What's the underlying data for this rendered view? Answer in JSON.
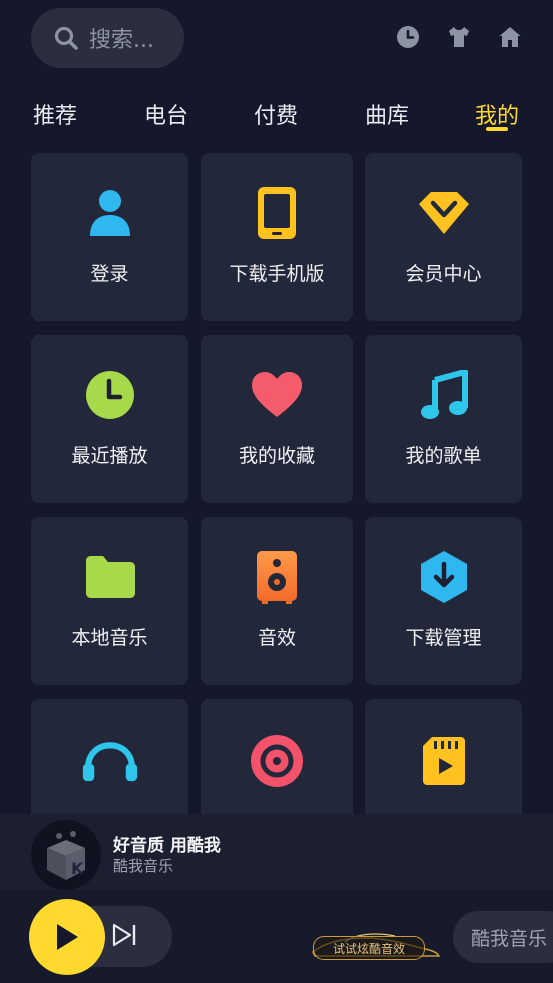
{
  "search": {
    "placeholder": "搜索..."
  },
  "tabs": [
    {
      "label": "推荐",
      "active": false
    },
    {
      "label": "电台",
      "active": false
    },
    {
      "label": "付费",
      "active": false
    },
    {
      "label": "曲库",
      "active": false
    },
    {
      "label": "我的",
      "active": true
    }
  ],
  "colors": {
    "accent": "#ffd92e",
    "background": "#15182a",
    "tile": "#23273a"
  },
  "tiles": [
    {
      "label": "登录",
      "icon": "user-icon"
    },
    {
      "label": "下载手机版",
      "icon": "phone-icon"
    },
    {
      "label": "会员中心",
      "icon": "vip-diamond-icon"
    },
    {
      "label": "最近播放",
      "icon": "clock-icon"
    },
    {
      "label": "我的收藏",
      "icon": "heart-icon"
    },
    {
      "label": "我的歌单",
      "icon": "music-note-icon"
    },
    {
      "label": "本地音乐",
      "icon": "folder-icon"
    },
    {
      "label": "音效",
      "icon": "speaker-icon"
    },
    {
      "label": "下载管理",
      "icon": "download-icon"
    },
    {
      "label": "",
      "icon": "headphones-icon"
    },
    {
      "label": "",
      "icon": "vinyl-icon"
    },
    {
      "label": "",
      "icon": "video-card-icon"
    }
  ],
  "now_playing": {
    "title": "好音质 用酷我",
    "artist": "酷我音乐"
  },
  "promo": {
    "label": "试试炫酷音效"
  },
  "app_name": "酷我音乐"
}
